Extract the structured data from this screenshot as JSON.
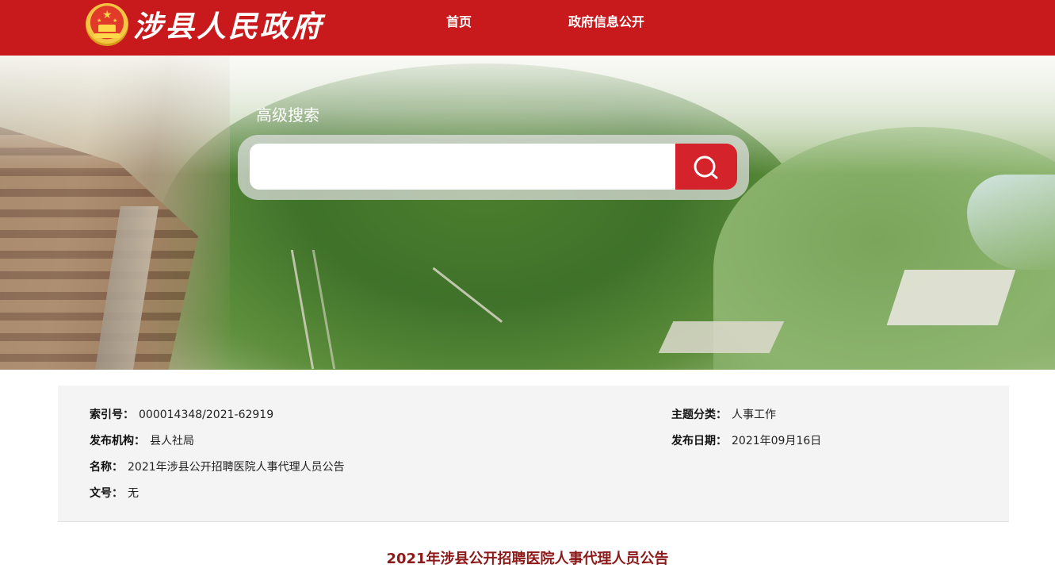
{
  "header": {
    "site_title": "涉县人民政府",
    "nav": [
      {
        "label": "首页"
      },
      {
        "label": "政府信息公开"
      }
    ]
  },
  "banner": {
    "search_heading": "高级搜索",
    "search_placeholder": "",
    "search_value": ""
  },
  "meta": {
    "index": {
      "label": "索引号",
      "sep": "：",
      "value": "000014348/2021-62919"
    },
    "org": {
      "label": "发布机构",
      "sep": "：",
      "value": "县人社局"
    },
    "name": {
      "label": "名称",
      "sep": "：",
      "value": "2021年涉县公开招聘医院人事代理人员公告"
    },
    "doc_no": {
      "label": "文号",
      "sep": "：",
      "value": "无"
    },
    "topic": {
      "label": "主题分类",
      "sep": "：",
      "value": "人事工作"
    },
    "date": {
      "label": "发布日期",
      "sep": "：",
      "value": "2021年09月16日"
    }
  },
  "article": {
    "title": "2021年涉县公开招聘医院人事代理人员公告"
  },
  "colors": {
    "header_red": "#c8191c",
    "search_button_red": "#d5232b",
    "title_dark_red": "#8c1a1a",
    "panel_gray": "#f4f4f4"
  }
}
